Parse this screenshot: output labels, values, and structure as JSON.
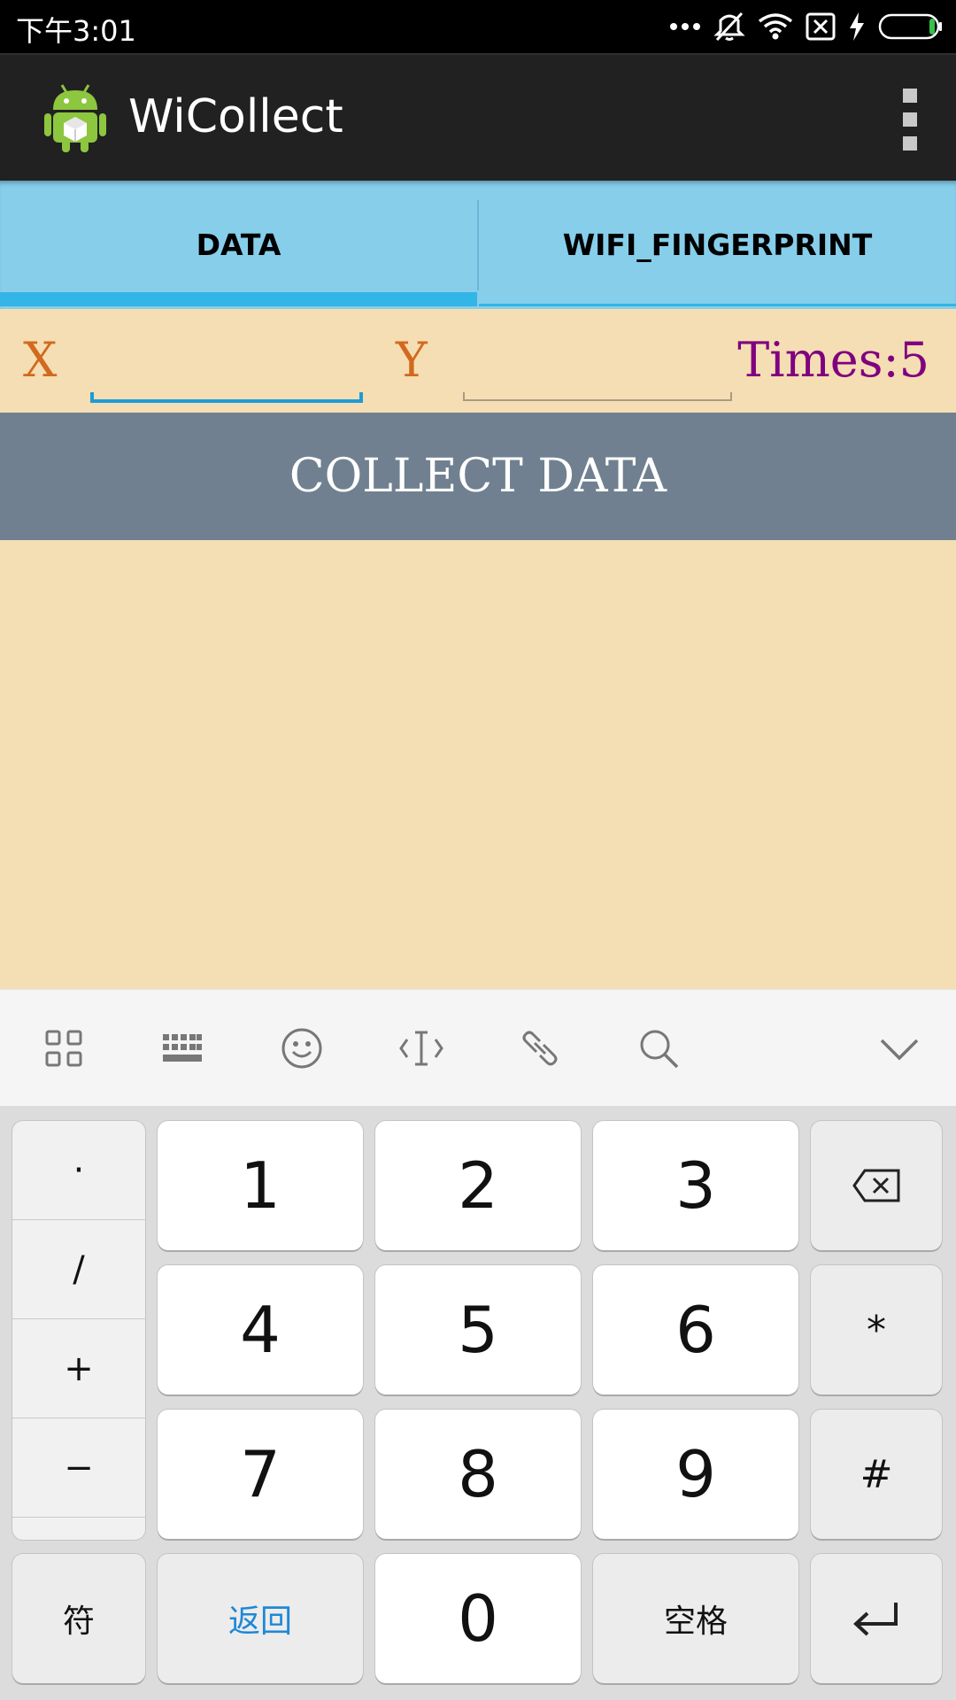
{
  "status_bar": {
    "time": "下午3:01",
    "icons": [
      "more-dots-icon",
      "vibrate-off-icon",
      "wifi-icon",
      "sim-x-icon",
      "charging-icon",
      "battery-icon"
    ]
  },
  "app": {
    "title": "WiCollect",
    "logo": "android-logo-icon",
    "menu_icon": "overflow-menu-icon"
  },
  "tabs": [
    {
      "label": "DATA",
      "selected": true
    },
    {
      "label": "WIFI_FINGERPRINT",
      "selected": false
    }
  ],
  "form": {
    "x_label": "X",
    "y_label": "Y",
    "x_value": "",
    "y_value": "",
    "times_label": "Times:5",
    "collect_button": "COLLECT DATA"
  },
  "keyboard": {
    "toolbar": [
      "grid-apps-icon",
      "keyboard-icon",
      "emoji-icon",
      "cursor-icon",
      "link-icon",
      "search-icon",
      "chevron-down-icon"
    ],
    "symbols": [
      "·",
      "/",
      "+",
      "−"
    ],
    "digits": {
      "one": "1",
      "two": "2",
      "three": "3",
      "four": "4",
      "five": "5",
      "six": "6",
      "seven": "7",
      "eight": "8",
      "nine": "9",
      "zero": "0"
    },
    "star": "*",
    "hash": "#",
    "fu": "符",
    "back": "返回",
    "space": "空格",
    "backspace_icon": "backspace-icon",
    "enter_icon": "enter-icon"
  },
  "colors": {
    "background": "#f5deb3",
    "tab_bar": "#87ceeb",
    "tab_indicator": "#33b5e5",
    "label_color": "#d2691e",
    "times_color": "#800080",
    "button": "#708090",
    "action_bar": "#212121"
  }
}
